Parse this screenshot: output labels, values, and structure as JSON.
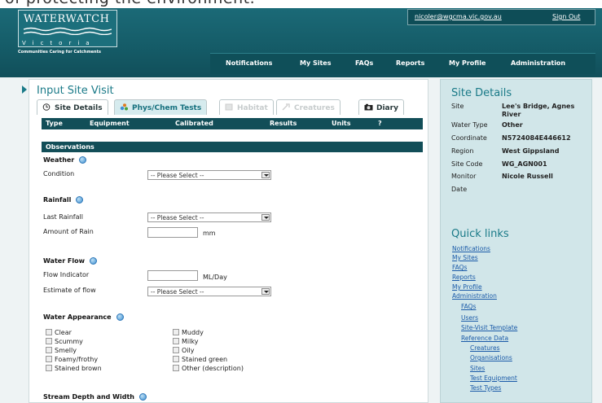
{
  "banner_fragment": "of protecting the environment.",
  "header": {
    "logo_title": "WATERWATCH",
    "logo_state": "Victoria",
    "tagline": "Communities Caring for Catchments",
    "user_email": "nicoler@wgcma.vic.gov.au",
    "sign_out": "Sign Out",
    "nav": [
      "Notifications",
      "My Sites",
      "FAQs",
      "Reports",
      "My Profile",
      "Administration"
    ]
  },
  "main": {
    "title": "Input Site Visit",
    "tabs": [
      {
        "label": "Site Details",
        "icon": "clock-icon",
        "state": "normal"
      },
      {
        "label": "Phys/Chem Tests",
        "icon": "molecule-icon",
        "state": "active"
      },
      {
        "label": "Habitat",
        "icon": "habitat-icon",
        "state": "disabled"
      },
      {
        "label": "Creatures",
        "icon": "creature-icon",
        "state": "disabled"
      },
      {
        "label": "Diary",
        "icon": "camera-icon",
        "state": "normal"
      }
    ],
    "grid_columns": [
      "Type",
      "Equipment",
      "Calibrated",
      "Results",
      "Units",
      "?"
    ],
    "observations_header": "Observations",
    "weather": {
      "title": "Weather",
      "condition_label": "Condition",
      "condition_value": "-- Please Select --"
    },
    "rainfall": {
      "title": "Rainfall",
      "last_label": "Last Rainfall",
      "last_value": "-- Please Select --",
      "amount_label": "Amount of Rain",
      "amount_value": "",
      "amount_unit": "mm"
    },
    "water_flow": {
      "title": "Water Flow",
      "indicator_label": "Flow Indicator",
      "indicator_value": "",
      "indicator_unit": "ML/Day",
      "estimate_label": "Estimate of flow",
      "estimate_value": "-- Please Select --"
    },
    "water_appearance": {
      "title": "Water Appearance",
      "options_left": [
        "Clear",
        "Scummy",
        "Smelly",
        "Foamy/frothy",
        "Stained brown"
      ],
      "options_right": [
        "Muddy",
        "Milky",
        "Oily",
        "Stained green",
        "Other (description)"
      ]
    },
    "stream_title": "Stream Depth and Width"
  },
  "sidebar": {
    "details_title": "Site Details",
    "details": [
      {
        "label": "Site",
        "value": "Lee's Bridge, Agnes River"
      },
      {
        "label": "Water Type",
        "value": "Other"
      },
      {
        "label": "Coordinate",
        "value": "N5724084E446612"
      },
      {
        "label": "Region",
        "value": "West Gippsland"
      },
      {
        "label": "Site Code",
        "value": "WG_AGN001"
      },
      {
        "label": "Monitor",
        "value": "Nicole Russell"
      },
      {
        "label": "Date",
        "value": ""
      }
    ],
    "quick_links_title": "Quick links",
    "links": [
      "Notifications",
      "My Sites",
      "FAQs",
      "Reports",
      "My Profile",
      "Administration"
    ],
    "admin_links": [
      "FAQs",
      "Users",
      "Site-Visit Template",
      "Reference Data"
    ],
    "reference_links": [
      "Creatures",
      "Organisations",
      "Sites",
      "Test Equipment",
      "Test Types"
    ]
  },
  "colors": {
    "teal_dark": "#124e58",
    "teal_title": "#1a7a88",
    "sidebar_bg": "#d1e6e9",
    "link": "#1a5aa8"
  }
}
